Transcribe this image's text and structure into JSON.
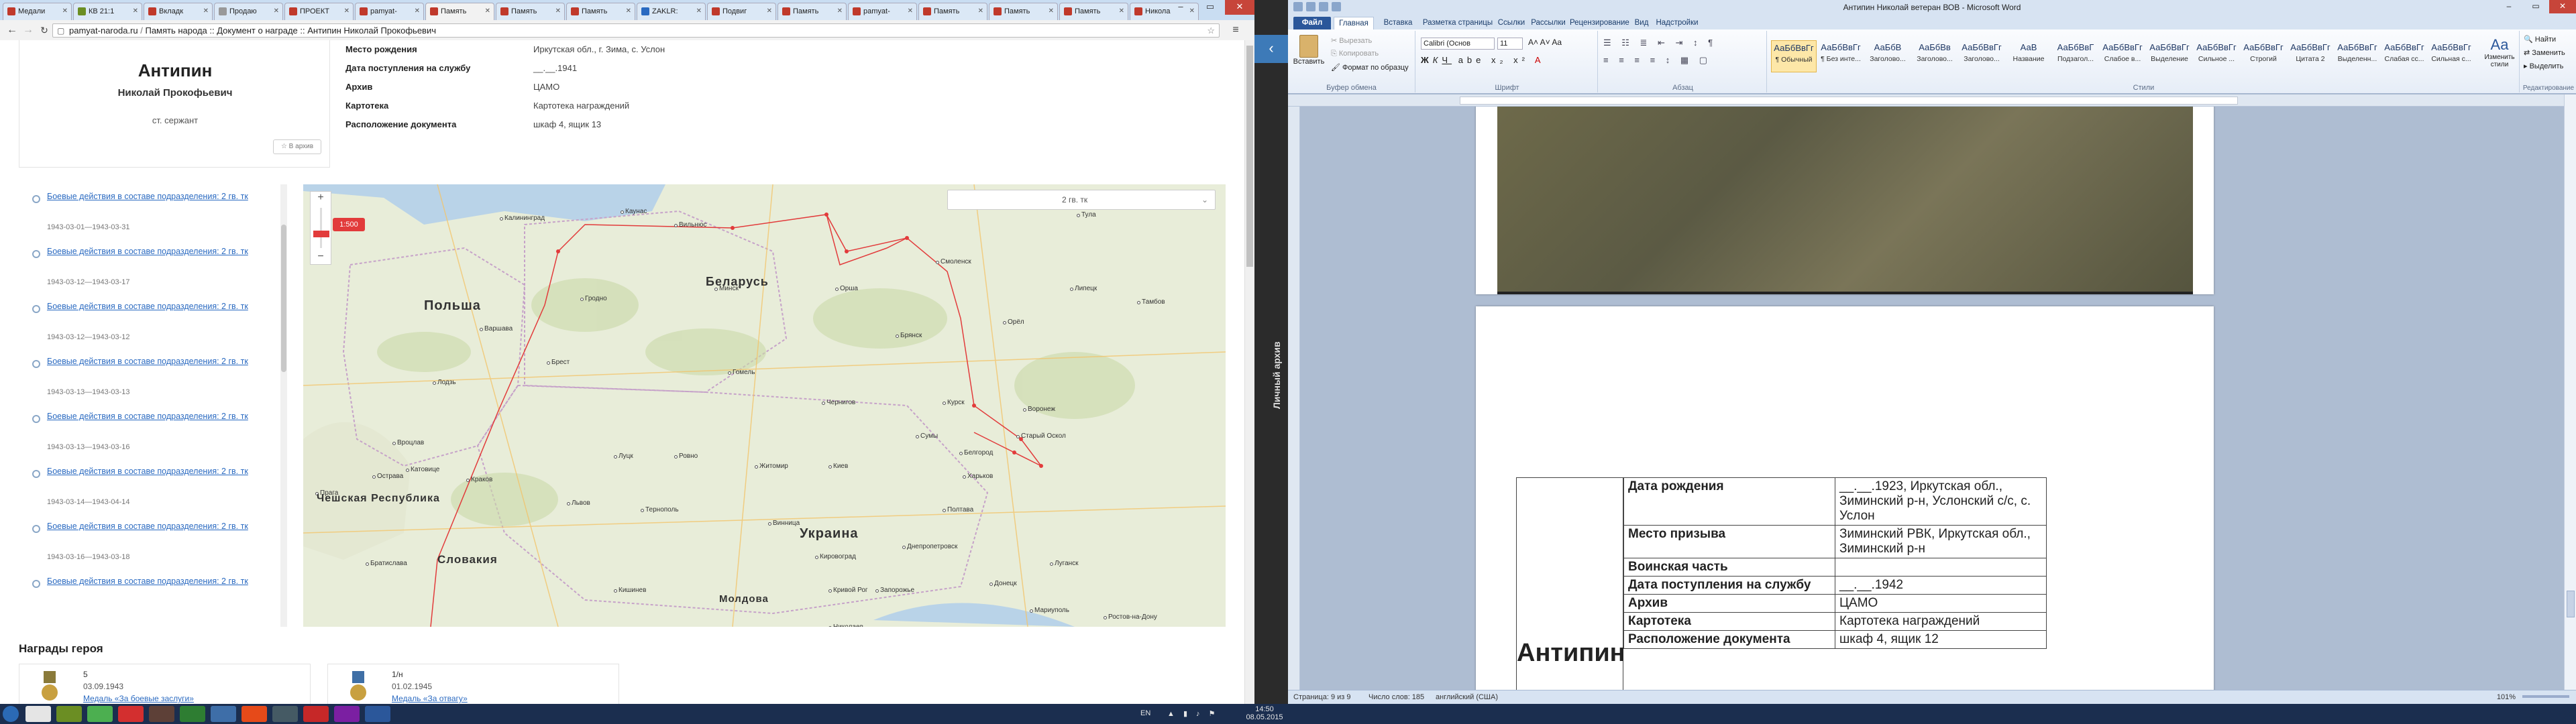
{
  "browser": {
    "tabs": [
      {
        "label": "Медали",
        "color": "#c0392b"
      },
      {
        "label": "КВ 21:1",
        "color": "#6b8e23"
      },
      {
        "label": "Вкладк",
        "color": "#c0392b"
      },
      {
        "label": "Продаю",
        "color": "#999999"
      },
      {
        "label": "ПРОЕКТ",
        "color": "#c0392b"
      },
      {
        "label": "pamyat-",
        "color": "#c0392b"
      },
      {
        "label": "Память",
        "color": "#c0392b",
        "active": true
      },
      {
        "label": "Память",
        "color": "#c0392b"
      },
      {
        "label": "Память",
        "color": "#c0392b"
      },
      {
        "label": "ZAKLR:",
        "color": "#2a6ac1"
      },
      {
        "label": "Подвиг",
        "color": "#c0392b"
      },
      {
        "label": "Память",
        "color": "#c0392b"
      },
      {
        "label": "pamyat-",
        "color": "#c0392b"
      },
      {
        "label": "Память",
        "color": "#c0392b"
      },
      {
        "label": "Память",
        "color": "#c0392b"
      },
      {
        "label": "Память",
        "color": "#c0392b"
      },
      {
        "label": "Никола",
        "color": "#c0392b"
      }
    ],
    "url_host": "pamyat-naroda.ru",
    "url_rest": "Память народа :: Документ о награде :: Антипин Николай Прокофьевич",
    "star": "☆",
    "menu": "≡"
  },
  "hero": {
    "surname": "Антипин",
    "name": "Николай Прокофьевич",
    "rank": "ст. сержант",
    "archive_btn": "☆ В архив"
  },
  "props": [
    {
      "k": "Место рождения",
      "v": "Иркутская обл., г. Зима, с. Услон"
    },
    {
      "k": "Дата поступления на службу",
      "v": "__.__.1941"
    },
    {
      "k": "Архив",
      "v": "ЦАМО"
    },
    {
      "k": "Картотека",
      "v": "Картотека награждений"
    },
    {
      "k": "Расположение документа",
      "v": "шкаф 4, ящик 13"
    }
  ],
  "events": [
    {
      "title": "Боевые действия в составе подразделения: 2 гв. тк",
      "dates": "1943-03-01—1943-03-31"
    },
    {
      "title": "Боевые действия в составе подразделения: 2 гв. тк",
      "dates": "1943-03-12—1943-03-17"
    },
    {
      "title": "Боевые действия в составе подразделения: 2 гв. тк",
      "dates": "1943-03-12—1943-03-12"
    },
    {
      "title": "Боевые действия в составе подразделения: 2 гв. тк",
      "dates": "1943-03-13—1943-03-13"
    },
    {
      "title": "Боевые действия в составе подразделения: 2 гв. тк",
      "dates": "1943-03-13—1943-03-16"
    },
    {
      "title": "Боевые действия в составе подразделения: 2 гв. тк",
      "dates": "1943-03-14—1943-04-14"
    },
    {
      "title": "Боевые действия в составе подразделения: 2 гв. тк",
      "dates": "1943-03-16—1943-03-18"
    },
    {
      "title": "Боевые действия в составе подразделения: 2 гв. тк",
      "dates": ""
    }
  ],
  "map": {
    "filter": "2 гв. тк",
    "scale": "1:500",
    "countries": [
      {
        "label": "Польша"
      },
      {
        "label": "Беларусь"
      },
      {
        "label": "Чешская Республика"
      },
      {
        "label": "Словакия"
      },
      {
        "label": "Украина"
      },
      {
        "label": "Молдова"
      }
    ],
    "cities": [
      "Калининград",
      "Каунас",
      "Вильнюс",
      "Гродно",
      "Минск",
      "Орша",
      "Смоленск",
      "Брянск",
      "Курск",
      "Харьков",
      "Белгород",
      "Воронеж",
      "Киев",
      "Житомир",
      "Винница",
      "Полтава",
      "Днепропетровск",
      "Запорожье",
      "Кривой Рог",
      "Николаев",
      "Донецк",
      "Луганск",
      "Варшава",
      "Лодзь",
      "Краков",
      "Катовице",
      "Вроцлав",
      "Острава",
      "Брест",
      "Гомель",
      "Чернигов",
      "Сумы",
      "Ровно",
      "Луцк",
      "Львов",
      "Тернополь",
      "Кировоград",
      "Прага",
      "Братислава",
      "Кишинев",
      "Ростов-на-Дону",
      "Мариуполь",
      "Тула",
      "Орёл",
      "Липецк",
      "Тамбов",
      "Старый Оскол"
    ]
  },
  "awards": {
    "title": "Награды героя",
    "items": [
      {
        "num": "5",
        "date": "03.09.1943",
        "link": "Медаль «За боевые заслуги»"
      },
      {
        "num": "1/н",
        "date": "01.02.1945",
        "link": "Медаль «За отвагу»"
      }
    ]
  },
  "sidepanel": {
    "label": "Личный архив",
    "arrow": "‹"
  },
  "word": {
    "title": "Антипин Николай ветеран ВОВ - Microsoft Word",
    "tabs": [
      "Файл",
      "Главная",
      "Вставка",
      "Разметка страницы",
      "Ссылки",
      "Рассылки",
      "Рецензирование",
      "Вид",
      "Надстройки"
    ],
    "clipboard": {
      "paste": "Вставить",
      "cut": "Вырезать",
      "copy": "Копировать",
      "format": "Формат по образцу",
      "group": "Буфер обмена"
    },
    "font": {
      "name": "Calibri (Основ",
      "size": "11",
      "group": "Шрифт"
    },
    "para_group": "Абзац",
    "styles": [
      {
        "preview": "АаБбВвГг",
        "name": "¶ Обычный",
        "sel": true
      },
      {
        "preview": "АаБбВвГг",
        "name": "¶ Без инте..."
      },
      {
        "preview": "АаБбВ",
        "name": "Заголово..."
      },
      {
        "preview": "АаБбВв",
        "name": "Заголово..."
      },
      {
        "preview": "АаБбВвГг",
        "name": "Заголово..."
      },
      {
        "preview": "АаВ",
        "name": "Название"
      },
      {
        "preview": "АаБбВвГ",
        "name": "Подзагол..."
      },
      {
        "preview": "АаБбВвГг",
        "name": "Слабое в..."
      },
      {
        "preview": "АаБбВвГг",
        "name": "Выделение"
      },
      {
        "preview": "АаБбВвГг",
        "name": "Сильное ..."
      },
      {
        "preview": "АаБбВвГг",
        "name": "Строгий"
      },
      {
        "preview": "АаБбВвГг",
        "name": "Цитата 2"
      },
      {
        "preview": "АаБбВвГг",
        "name": "Выделенн..."
      },
      {
        "preview": "АаБбВвГг",
        "name": "Слабая сс..."
      },
      {
        "preview": "АаБбВвГг",
        "name": "Сильная с..."
      }
    ],
    "styles_group": "Стили",
    "change_styles": "Изменить стили",
    "editing": {
      "find": "Найти",
      "replace": "Заменить",
      "select": "Выделить",
      "group": "Редактирование"
    },
    "doc_surname": "Антипин",
    "table": [
      {
        "k": "Дата рождения",
        "v": "__.__.1923, Иркутская обл., Зиминский р-н, Услонский с/с, с. Услон"
      },
      {
        "k": "Место призыва",
        "v": "Зиминский РВК, Иркутская обл., Зиминский р-н"
      },
      {
        "k": "Воинская часть",
        "v": ""
      },
      {
        "k": "Дата поступления на службу",
        "v": "__.__.1942"
      },
      {
        "k": "Архив",
        "v": "ЦАМО"
      },
      {
        "k": "Картотека",
        "v": "Картотека награждений"
      },
      {
        "k": "Расположение документа",
        "v": "шкаф 4, ящик 12"
      }
    ],
    "status": {
      "page": "Страница: 9 из 9",
      "words": "Число слов: 185",
      "lang": "английский (США)",
      "zoom": "101%"
    }
  },
  "taskbar": {
    "lang": "EN",
    "time": "14:50",
    "date": "08.05.2015"
  }
}
